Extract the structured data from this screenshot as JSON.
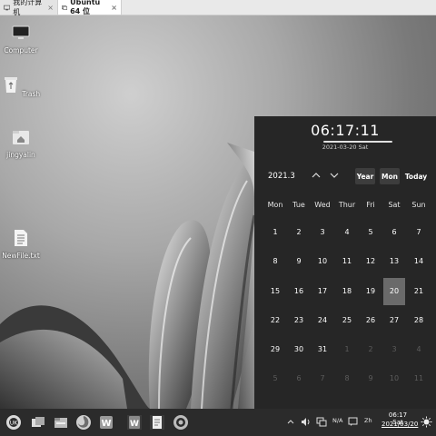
{
  "tabs": [
    {
      "label": "我的计算机",
      "close": "×"
    },
    {
      "label": "Ubuntu 64 位",
      "close": "×"
    }
  ],
  "desktop_icons": [
    {
      "label": "Computer",
      "icon": "monitor-icon"
    },
    {
      "label": "Trash",
      "icon": "trash-icon"
    },
    {
      "label": "jingyalin",
      "icon": "home-folder-icon"
    },
    {
      "label": "NewFile.txt",
      "icon": "text-file-icon"
    }
  ],
  "calendar": {
    "time": "06:17:11",
    "date": "2021-03-20 Sat",
    "month": "2021.3",
    "buttons": {
      "year": "Year",
      "mon": "Mon",
      "today": "Today"
    },
    "weekdays": [
      "Mon",
      "Tue",
      "Wed",
      "Thur",
      "Fri",
      "Sat",
      "Sun"
    ],
    "weeks": [
      [
        "1",
        "2",
        "3",
        "4",
        "5",
        "6",
        "7"
      ],
      [
        "8",
        "9",
        "10",
        "11",
        "12",
        "13",
        "14"
      ],
      [
        "15",
        "16",
        "17",
        "18",
        "19",
        "20",
        "21"
      ],
      [
        "22",
        "23",
        "24",
        "25",
        "26",
        "27",
        "28"
      ],
      [
        "29",
        "30",
        "31",
        "1",
        "2",
        "3",
        "4"
      ],
      [
        "5",
        "6",
        "7",
        "8",
        "9",
        "10",
        "11"
      ]
    ],
    "selected_day": "20"
  },
  "tray": {
    "network": "N/A",
    "input_method": "Zh"
  },
  "clock": {
    "time": "06:17 Sat",
    "date": "2021/03/20"
  },
  "colors": {
    "panel": "#262626",
    "taskbar": "#2b2b2b",
    "selected": "#6a6a6a"
  }
}
